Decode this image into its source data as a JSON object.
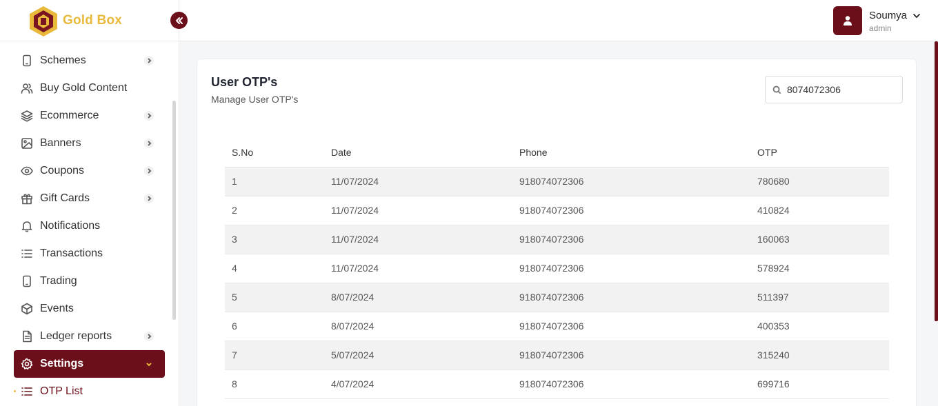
{
  "brand": {
    "name": "Gold Box"
  },
  "user": {
    "name": "Soumya",
    "role": "admin"
  },
  "sidebar": {
    "items": [
      {
        "label": "Schemes",
        "icon": "phone-icon",
        "has_chevron": true
      },
      {
        "label": "Buy Gold Content",
        "icon": "users-icon",
        "has_chevron": false
      },
      {
        "label": "Ecommerce",
        "icon": "layers-icon",
        "has_chevron": true
      },
      {
        "label": "Banners",
        "icon": "image-icon",
        "has_chevron": true
      },
      {
        "label": "Coupons",
        "icon": "eye-icon",
        "has_chevron": true
      },
      {
        "label": "Gift Cards",
        "icon": "gift-icon",
        "has_chevron": true
      },
      {
        "label": "Notifications",
        "icon": "bell-icon",
        "has_chevron": false
      },
      {
        "label": "Transactions",
        "icon": "list-icon",
        "has_chevron": false
      },
      {
        "label": "Trading",
        "icon": "phone-icon",
        "has_chevron": false
      },
      {
        "label": "Events",
        "icon": "cube-icon",
        "has_chevron": false
      },
      {
        "label": "Ledger reports",
        "icon": "file-icon",
        "has_chevron": true
      },
      {
        "label": "Settings",
        "icon": "gear-icon",
        "has_chevron": true,
        "active": true
      },
      {
        "label": "OTP List",
        "icon": "list-icon",
        "sub": true
      }
    ]
  },
  "page": {
    "title": "User OTP's",
    "subtitle": "Manage User OTP's",
    "search": {
      "value": "8074072306"
    }
  },
  "table": {
    "headers": [
      "S.No",
      "Date",
      "Phone",
      "OTP"
    ],
    "rows": [
      [
        "1",
        "11/07/2024",
        "918074072306",
        "780680"
      ],
      [
        "2",
        "11/07/2024",
        "918074072306",
        "410824"
      ],
      [
        "3",
        "11/07/2024",
        "918074072306",
        "160063"
      ],
      [
        "4",
        "11/07/2024",
        "918074072306",
        "578924"
      ],
      [
        "5",
        "8/07/2024",
        "918074072306",
        "511397"
      ],
      [
        "6",
        "8/07/2024",
        "918074072306",
        "400353"
      ],
      [
        "7",
        "5/07/2024",
        "918074072306",
        "315240"
      ],
      [
        "8",
        "4/07/2024",
        "918074072306",
        "699716"
      ]
    ]
  },
  "colors": {
    "primary": "#6b0f1a",
    "gold": "#e8b93a"
  }
}
